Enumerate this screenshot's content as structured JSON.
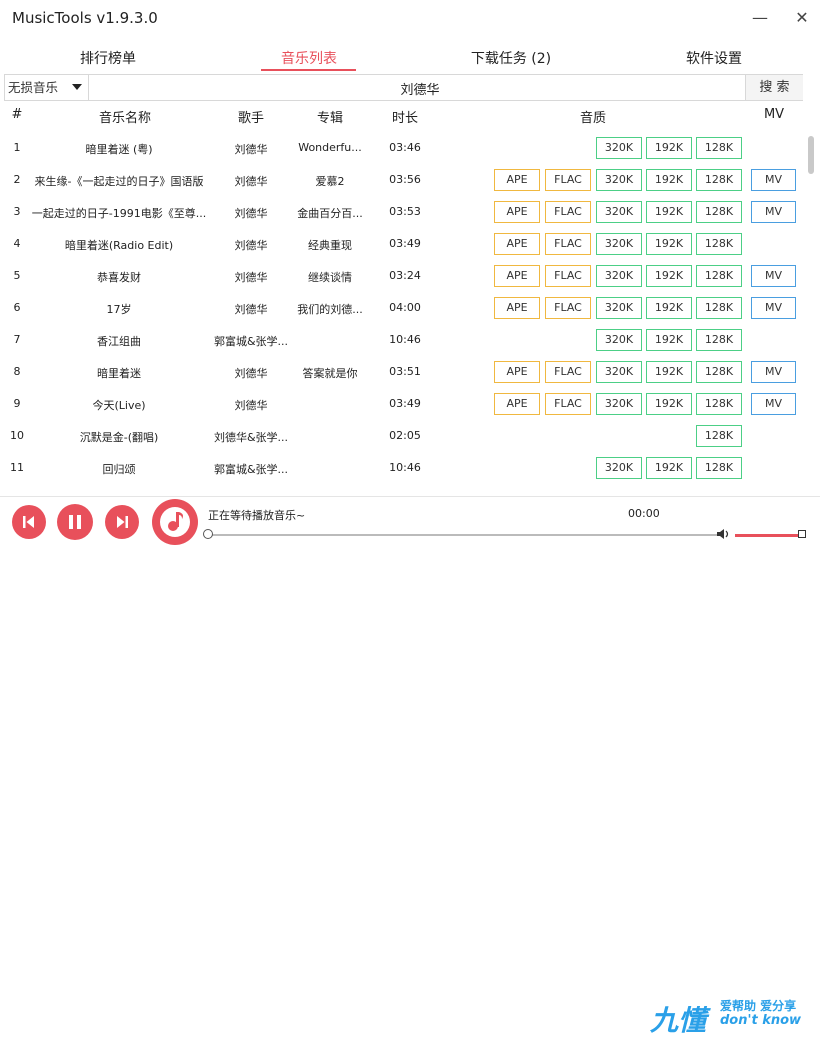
{
  "app": {
    "title": "MusicTools v1.9.3.0",
    "minimize_glyph": "—",
    "close_glyph": "✕"
  },
  "tabs": [
    "排行榜单",
    "音乐列表",
    "下载任务 (2)",
    "软件设置"
  ],
  "active_tab": 1,
  "search": {
    "source": "无损音乐",
    "query": "刘德华",
    "button": "搜 索"
  },
  "table": {
    "headers": {
      "index": "#",
      "name": "音乐名称",
      "artist": "歌手",
      "album": "专辑",
      "duration": "时长",
      "quality": "音质",
      "mv": "MV"
    },
    "rows": [
      {
        "index": "1",
        "name": "暗里着迷 (粤)",
        "artist": "刘德华",
        "album": "Wonderfu...",
        "duration": "03:46",
        "ape": "",
        "flac": "",
        "q320": "320K",
        "q192": "192K",
        "q128": "128K",
        "mv": ""
      },
      {
        "index": "2",
        "name": "来生缘-《一起走过的日子》国语版",
        "artist": "刘德华",
        "album": "爱慕2",
        "duration": "03:56",
        "ape": "APE",
        "flac": "FLAC",
        "q320": "320K",
        "q192": "192K",
        "q128": "128K",
        "mv": "MV"
      },
      {
        "index": "3",
        "name": "一起走过的日子-1991电影《至尊...",
        "artist": "刘德华",
        "album": "金曲百分百...",
        "duration": "03:53",
        "ape": "APE",
        "flac": "FLAC",
        "q320": "320K",
        "q192": "192K",
        "q128": "128K",
        "mv": "MV"
      },
      {
        "index": "4",
        "name": "暗里着迷(Radio Edit)",
        "artist": "刘德华",
        "album": "经典重现",
        "duration": "03:49",
        "ape": "APE",
        "flac": "FLAC",
        "q320": "320K",
        "q192": "192K",
        "q128": "128K",
        "mv": ""
      },
      {
        "index": "5",
        "name": "恭喜发财",
        "artist": "刘德华",
        "album": "继续谈情",
        "duration": "03:24",
        "ape": "APE",
        "flac": "FLAC",
        "q320": "320K",
        "q192": "192K",
        "q128": "128K",
        "mv": "MV"
      },
      {
        "index": "6",
        "name": "17岁",
        "artist": "刘德华",
        "album": "我们的刘德...",
        "duration": "04:00",
        "ape": "APE",
        "flac": "FLAC",
        "q320": "320K",
        "q192": "192K",
        "q128": "128K",
        "mv": "MV"
      },
      {
        "index": "7",
        "name": "香江组曲",
        "artist": "郭富城&张学...",
        "album": "",
        "duration": "10:46",
        "ape": "",
        "flac": "",
        "q320": "320K",
        "q192": "192K",
        "q128": "128K",
        "mv": ""
      },
      {
        "index": "8",
        "name": "暗里着迷",
        "artist": "刘德华",
        "album": "答案就是你",
        "duration": "03:51",
        "ape": "APE",
        "flac": "FLAC",
        "q320": "320K",
        "q192": "192K",
        "q128": "128K",
        "mv": "MV"
      },
      {
        "index": "9",
        "name": "今天(Live)",
        "artist": "刘德华",
        "album": "",
        "duration": "03:49",
        "ape": "APE",
        "flac": "FLAC",
        "q320": "320K",
        "q192": "192K",
        "q128": "128K",
        "mv": "MV"
      },
      {
        "index": "10",
        "name": "沉默是金-(翻唱)",
        "artist": "刘德华&张学...",
        "album": "",
        "duration": "02:05",
        "ape": "",
        "flac": "",
        "q320": "",
        "q192": "",
        "q128": "128K",
        "mv": ""
      },
      {
        "index": "11",
        "name": "回归颂",
        "artist": "郭富城&张学...",
        "album": "",
        "duration": "10:46",
        "ape": "",
        "flac": "",
        "q320": "320K",
        "q192": "192K",
        "q128": "128K",
        "mv": ""
      }
    ]
  },
  "player": {
    "status": "正在等待播放音乐~",
    "time": "00:00",
    "progress": 0,
    "volume": 1.0
  },
  "watermark": {
    "logo": "九懂",
    "line1": "爱帮助 爱分享",
    "line2": "don't know"
  },
  "colors": {
    "accent": "#e8505b",
    "ape_flac_border": "#f0b840",
    "bitrate_border": "#4ccf86",
    "mv_border": "#4a9ee0"
  }
}
